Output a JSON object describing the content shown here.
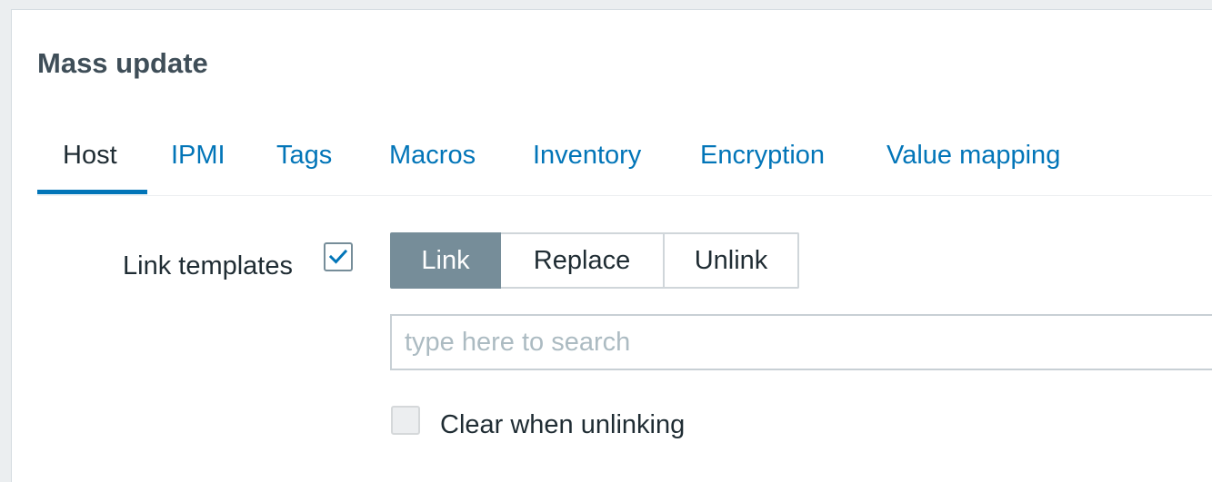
{
  "dialog": {
    "title": "Mass update"
  },
  "tabs": [
    {
      "label": "Host",
      "active": true
    },
    {
      "label": "IPMI",
      "active": false
    },
    {
      "label": "Tags",
      "active": false
    },
    {
      "label": "Macros",
      "active": false
    },
    {
      "label": "Inventory",
      "active": false
    },
    {
      "label": "Encryption",
      "active": false
    },
    {
      "label": "Value mapping",
      "active": false
    }
  ],
  "form": {
    "link_templates_label": "Link templates",
    "link_templates_checked": true,
    "mode_options": [
      {
        "label": "Link",
        "selected": true
      },
      {
        "label": "Replace",
        "selected": false
      },
      {
        "label": "Unlink",
        "selected": false
      }
    ],
    "search": {
      "placeholder": "type here to search",
      "value": ""
    },
    "clear_when_unlinking_label": "Clear when unlinking",
    "clear_when_unlinking_checked": false
  },
  "colors": {
    "accent": "#0275b8",
    "segment_active": "#768d99",
    "title": "#3f4e58",
    "text": "#1f2c33",
    "placeholder": "#acbbc2"
  },
  "icons": {
    "checkbox_mark": "check-icon"
  }
}
